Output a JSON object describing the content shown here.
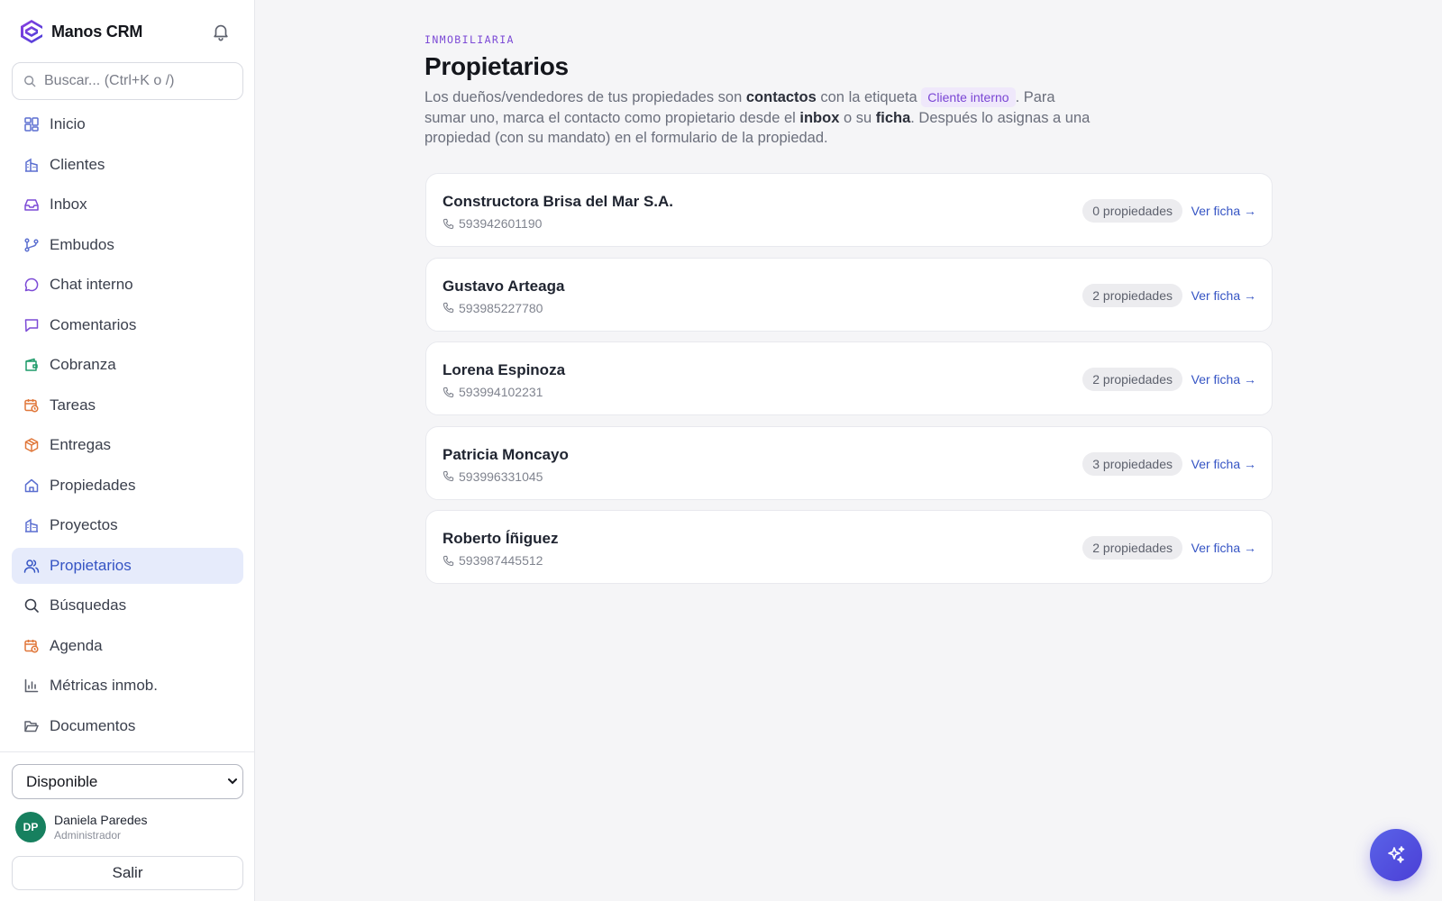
{
  "app": {
    "name": "Manos CRM"
  },
  "search": {
    "placeholder": "Buscar... (Ctrl+K o /)"
  },
  "sidebar": {
    "items": [
      {
        "label": "Inicio",
        "icon": "dashboard-icon"
      },
      {
        "label": "Clientes",
        "icon": "building-icon"
      },
      {
        "label": "Inbox",
        "icon": "inbox-icon"
      },
      {
        "label": "Embudos",
        "icon": "git-branch-icon"
      },
      {
        "label": "Chat interno",
        "icon": "chat-bubble-icon"
      },
      {
        "label": "Comentarios",
        "icon": "comment-icon"
      },
      {
        "label": "Cobranza",
        "icon": "wallet-icon"
      },
      {
        "label": "Tareas",
        "icon": "calendar-clock-icon"
      },
      {
        "label": "Entregas",
        "icon": "package-icon"
      },
      {
        "label": "Propiedades",
        "icon": "home-icon"
      },
      {
        "label": "Proyectos",
        "icon": "building-icon"
      },
      {
        "label": "Propietarios",
        "icon": "users-icon",
        "active": true
      },
      {
        "label": "Búsquedas",
        "icon": "search-icon"
      },
      {
        "label": "Agenda",
        "icon": "calendar-clock-icon"
      },
      {
        "label": "Métricas inmob.",
        "icon": "bar-chart-icon"
      },
      {
        "label": "Documentos",
        "icon": "folder-open-icon"
      }
    ]
  },
  "status": {
    "selected": "Disponible"
  },
  "user": {
    "initials": "DP",
    "name": "Daniela Paredes",
    "role": "Administrador"
  },
  "logout_label": "Salir",
  "page": {
    "eyebrow": "INMOBILIARIA",
    "title": "Propietarios",
    "desc": {
      "p1": "Los dueños/vendedores de tus propiedades son ",
      "b1": "contactos",
      "p2": " con la etiqueta ",
      "tag": "Cliente interno",
      "p3": ". Para sumar uno, marca el contacto como propietario desde el ",
      "b2": "inbox",
      "p4": " o su ",
      "b3": "ficha",
      "p5": ". Después lo asignas a una propiedad (con su mandato) en el formulario de la propiedad."
    }
  },
  "owners": [
    {
      "name": "Constructora Brisa del Mar S.A.",
      "phone": "593942601190",
      "count": "0 propiedades",
      "link": "Ver ficha →"
    },
    {
      "name": "Gustavo Arteaga",
      "phone": "593985227780",
      "count": "2 propiedades",
      "link": "Ver ficha →"
    },
    {
      "name": "Lorena Espinoza",
      "phone": "593994102231",
      "count": "2 propiedades",
      "link": "Ver ficha →"
    },
    {
      "name": "Patricia Moncayo",
      "phone": "593996331045",
      "count": "3 propiedades",
      "link": "Ver ficha →"
    },
    {
      "name": "Roberto Íñiguez",
      "phone": "593987445512",
      "count": "2 propiedades",
      "link": "Ver ficha →"
    }
  ],
  "colors": {
    "accent": "#3554c4",
    "active_bg": "#e6ebfb",
    "eyebrow": "#7c4ad6",
    "avatar": "#17805f",
    "fab": "#4b3fd6"
  },
  "fab": {
    "icon": "sparkles-icon"
  }
}
